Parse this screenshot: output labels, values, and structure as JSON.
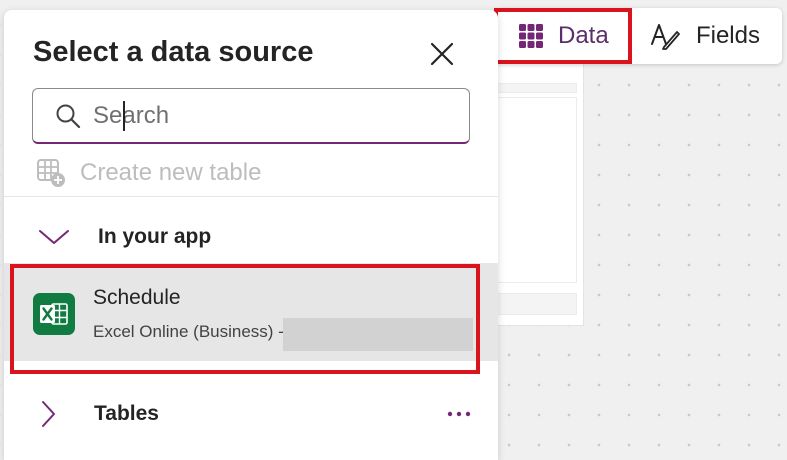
{
  "toolbar": {
    "data_label": "Data",
    "fields_label": "Fields",
    "accent": "#742774"
  },
  "panel": {
    "title": "Select a data source",
    "search_placeholder": "Search",
    "create_new_label": "Create new table",
    "sections": {
      "in_your_app": "In your app",
      "tables": "Tables"
    },
    "items": [
      {
        "name": "Schedule",
        "connector": "Excel Online (Business) -",
        "icon": "excel-icon",
        "selected": true
      }
    ]
  },
  "highlight_color": "#d9141c"
}
